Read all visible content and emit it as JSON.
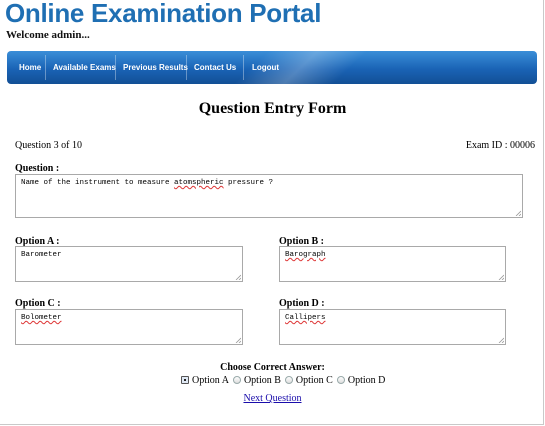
{
  "site": {
    "title": "Online Examination Portal",
    "welcome": "Welcome admin..."
  },
  "nav": {
    "items": [
      "Home",
      "Available Exams",
      "Previous Results",
      "Contact Us",
      "Logout"
    ]
  },
  "form": {
    "heading": "Question Entry Form",
    "question_counter": "Question 3 of 10",
    "exam_id": "Exam ID : 00006",
    "question_label": "Question :",
    "question_text_before": "Name of the instrument to measure ",
    "question_text_misspelled": "atomspheric",
    "question_text_after": " pressure ?",
    "option_a_label": "Option A :",
    "option_a_value": "Barometer",
    "option_b_label": "Option B :",
    "option_b_value": "Barograph",
    "option_c_label": "Option C :",
    "option_c_value": "Bolometer",
    "option_d_label": "Option D :",
    "option_d_value": "Callipers",
    "choose_label": "Choose Correct Answer:",
    "answer_options": [
      "Option A",
      "Option B",
      "Option C",
      "Option D"
    ],
    "selected_answer": "Option A",
    "next_link": "Next Question"
  },
  "colors": {
    "title": "#1f6fb3",
    "navbar": "#1a63b5",
    "link": "#1a0dab"
  }
}
